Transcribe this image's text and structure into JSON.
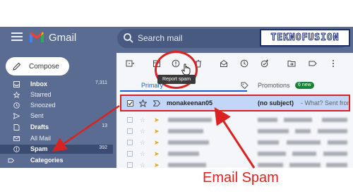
{
  "app": {
    "title": "Gmail"
  },
  "search": {
    "placeholder": "Search mail"
  },
  "brand": {
    "watermark": "TEKNOFUSION"
  },
  "compose": {
    "label": "Compose"
  },
  "sidebar": {
    "items": [
      {
        "label": "Inbox",
        "count": "7,311",
        "icon": "inbox-icon",
        "bold": true
      },
      {
        "label": "Starred",
        "icon": "star-icon"
      },
      {
        "label": "Snoozed",
        "icon": "clock-icon"
      },
      {
        "label": "Sent",
        "icon": "send-icon"
      },
      {
        "label": "Drafts",
        "count": "13",
        "icon": "draft-icon",
        "bold": true
      },
      {
        "label": "All Mail",
        "icon": "all-mail-icon"
      },
      {
        "label": "Spam",
        "count": "392",
        "icon": "spam-icon",
        "bold": true,
        "active": true
      },
      {
        "label": "Categories",
        "icon": "label-icon",
        "bold": true
      }
    ]
  },
  "toolbar": {
    "tooltip": "Report spam",
    "icons": [
      "select-all-icon",
      "archive-icon",
      "report-spam-icon",
      "delete-icon",
      "mark-read-icon",
      "snooze-icon",
      "add-task-icon",
      "move-to-icon",
      "label-icon",
      "more-icon"
    ]
  },
  "tabs": [
    {
      "label": "Primary",
      "active": true
    },
    {
      "label": "Promotions",
      "badge": "6 new"
    }
  ],
  "email": {
    "sender": "monakeenan05",
    "subject": "(no subject)",
    "snippet": "- What? Sent from"
  },
  "annotation": {
    "label": "Email Spam"
  },
  "colors": {
    "accent_red": "#d92323",
    "frame": "#5a6c92",
    "selected_row": "#c2d7f8",
    "promo_badge": "#188038",
    "tab_blue": "#1a5fd6"
  }
}
